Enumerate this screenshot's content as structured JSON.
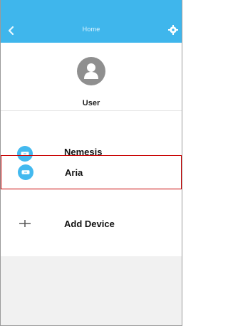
{
  "header": {
    "title": "Home"
  },
  "profile": {
    "username": "User"
  },
  "devices": [
    {
      "label": "Nemesis"
    },
    {
      "label": "Aria"
    }
  ],
  "add_device": {
    "label": "Add Device"
  },
  "colors": {
    "header": "#3fb6ec",
    "device_icon": "#43b9ef",
    "selection_border": "#c80000"
  }
}
